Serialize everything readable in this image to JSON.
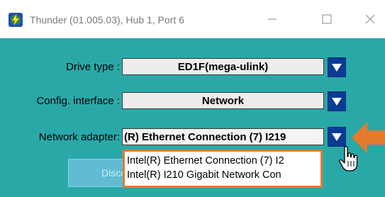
{
  "window": {
    "title": "Thunder (01.005.03), Hub 1, Port 6",
    "app_icon": "thunder-app-icon",
    "controls": [
      "minimize-icon",
      "maximize-icon",
      "close-icon"
    ]
  },
  "form": {
    "drive_type": {
      "label": "Drive type :",
      "value": "ED1F(mega-ulink)"
    },
    "config_interface": {
      "label": "Config. interface :",
      "value": "Network"
    },
    "network_adapter": {
      "label": "Network adapter:",
      "value": "(R) Ethernet Connection (7) I219"
    }
  },
  "dropdown": {
    "options": [
      "Intel(R) Ethernet Connection (7) I2",
      "Intel(R) I210 Gigabit Network Con"
    ]
  },
  "disconnect_button": {
    "label": "Disco"
  },
  "colors": {
    "client_background": "#2aa8a8",
    "dropdown_button": "#0a3c96",
    "highlight": "#e47a2e",
    "disconnect_button": "#61bcd3"
  },
  "icons": {
    "dropdown_arrow": "triangle-down-icon",
    "annotation": "orange-arrow-icon",
    "pointer": "hand-cursor-icon"
  }
}
